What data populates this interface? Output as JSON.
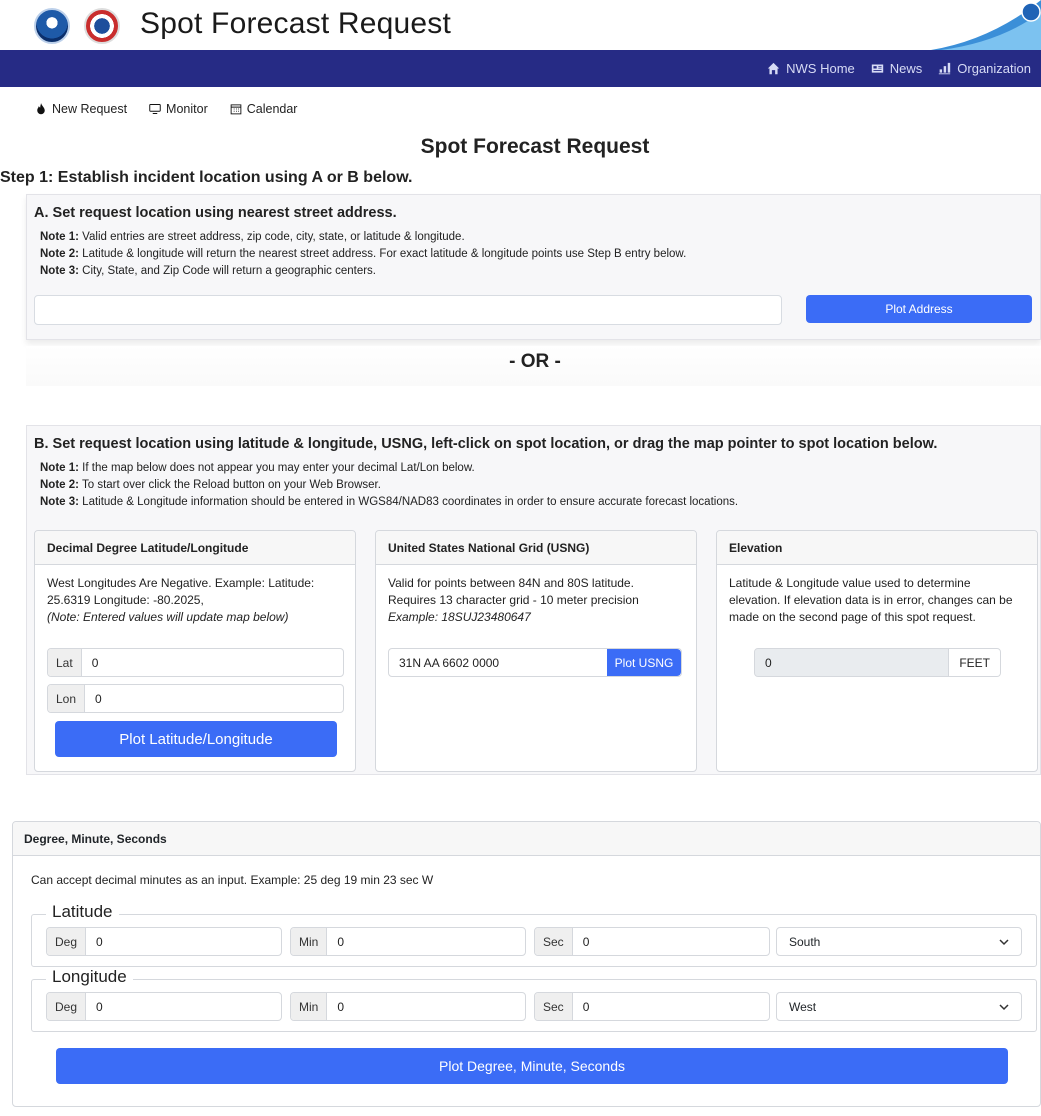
{
  "header": {
    "title": "Spot Forecast Request",
    "nav": [
      "NWS Home",
      "News",
      "Organization"
    ],
    "brand_color": "#262b85"
  },
  "subnav": [
    "New Request",
    "Monitor",
    "Calendar"
  ],
  "page_title": "Spot Forecast Request",
  "step1": "Step 1: Establish incident location using A or B below.",
  "section_a": {
    "title": "A. Set request location using nearest street address.",
    "notes": [
      {
        "label": "Note 1:",
        "text": " Valid entries are street address, zip code, city, state, or latitude & longitude."
      },
      {
        "label": "Note 2:",
        "text": " Latitude & longitude will return the nearest street address. For exact latitude & longitude points use Step B entry below."
      },
      {
        "label": "Note 3:",
        "text": " City, State, and Zip Code will return a geographic centers."
      }
    ],
    "address_value": "",
    "plot_button": "Plot Address"
  },
  "or_text": "- OR -",
  "section_b": {
    "title": "B. Set request location using latitude & longitude, USNG, left-click on spot location, or drag the map pointer to spot location below.",
    "notes": [
      {
        "label": "Note 1:",
        "text": " If the map below does not appear you may enter your decimal Lat/Lon below."
      },
      {
        "label": "Note 2:",
        "text": " To start over click the Reload button on your Web Browser."
      },
      {
        "label": "Note 3:",
        "text": " Latitude & Longitude information should be entered in WGS84/NAD83 coordinates in order to ensure accurate forecast locations."
      }
    ],
    "decimal": {
      "header": "Decimal Degree Latitude/Longitude",
      "desc": "West Longitudes Are Negative. Example: Latitude: 25.6319 Longitude: -80.2025,",
      "note": "(Note: Entered values will update map below)",
      "lat_label": "Lat",
      "lat_value": "0",
      "lon_label": "Lon",
      "lon_value": "0",
      "button": "Plot Latitude/Longitude"
    },
    "usng": {
      "header": "United States National Grid (USNG)",
      "desc": "Valid for points between 84N and 80S latitude. Requires 13 character grid - 10 meter precision",
      "example": "Example: 18SUJ23480647",
      "value": "31N AA 6602 0000",
      "button": "Plot USNG"
    },
    "elevation": {
      "header": "Elevation",
      "desc": "Latitude & Longitude value used to determine elevation. If elevation data is in error, changes can be made on the second page of this spot request.",
      "value": "0",
      "unit": "FEET"
    }
  },
  "dms": {
    "header": "Degree, Minute, Seconds",
    "desc": "Can accept decimal minutes as an input. Example: 25 deg 19 min 23 sec W",
    "latitude": {
      "legend": "Latitude",
      "deg": "0",
      "min": "0",
      "sec": "0",
      "hemisphere": "South"
    },
    "longitude": {
      "legend": "Longitude",
      "deg": "0",
      "min": "0",
      "sec": "0",
      "hemisphere": "West"
    },
    "labels": {
      "deg": "Deg",
      "min": "Min",
      "sec": "Sec"
    },
    "button": "Plot Degree, Minute, Seconds"
  }
}
